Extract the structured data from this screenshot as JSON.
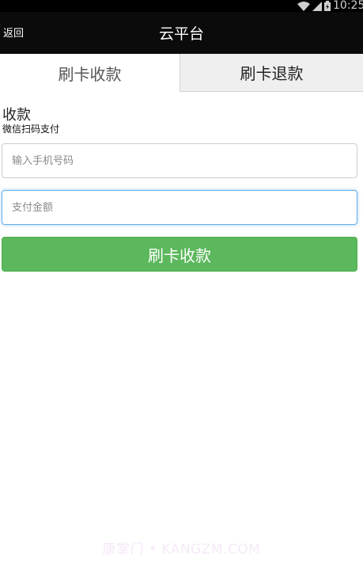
{
  "status_bar": {
    "time": "10:25",
    "icons": [
      "wifi-icon",
      "signal-icon",
      "battery-icon"
    ]
  },
  "header": {
    "back_label": "返回",
    "title": "云平台"
  },
  "tabs": [
    {
      "label": "刷卡收款",
      "active": true
    },
    {
      "label": "刷卡退款",
      "active": false
    }
  ],
  "form": {
    "section_title": "收款",
    "section_subtitle": "微信扫码支付",
    "phone_placeholder": "输入手机号码",
    "amount_placeholder": "支付金额",
    "submit_label": "刷卡收款"
  },
  "watermark": "康掌门 • KANGZM.COM",
  "colors": {
    "header_bg": "#0b0b0b",
    "inactive_tab_bg": "#efefef",
    "button_green": "#5cb85c",
    "focus_border": "#66afe9"
  }
}
